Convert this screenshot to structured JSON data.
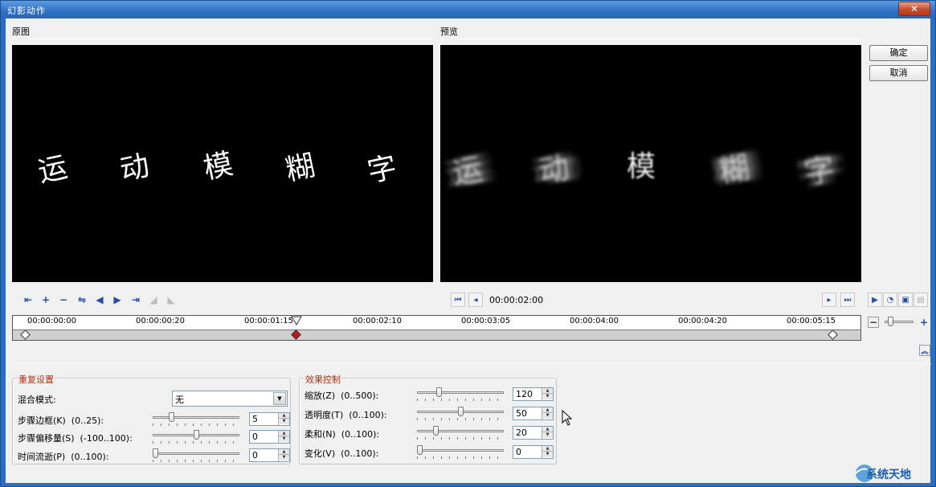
{
  "window": {
    "title": "幻影动作",
    "close_glyph": "✕"
  },
  "original": {
    "label": "原图",
    "chars": [
      "运",
      "动",
      "模",
      "糊",
      "字"
    ]
  },
  "preview": {
    "label": "预览",
    "chars": [
      "运",
      "动",
      "模",
      "糊",
      "字"
    ],
    "timecode": "00:00:02:00"
  },
  "buttons": {
    "ok": "确定",
    "cancel": "取消"
  },
  "timeline": {
    "ticks": [
      "00:00:00:00",
      "00:00:00:20",
      "00:00:01:15",
      "00:00:02:10",
      "00:00:03:05",
      "00:00:04:00",
      "00:00:04:20",
      "00:00:05:15"
    ],
    "zoom_minus": "−",
    "zoom_plus": "+",
    "collapse_glyph": "︽"
  },
  "repeat_group": {
    "title": "重复设置",
    "blend_mode_label": "混合模式:",
    "blend_mode_value": "无",
    "rows": [
      {
        "label": "步骤边框(K)  (0..25):",
        "value": "5",
        "level": 0.2
      },
      {
        "label": "步骤偏移量(S)  (-100..100):",
        "value": "0",
        "level": 0.5
      },
      {
        "label": "时间流逝(P)  (0..100):",
        "value": "0",
        "level": 0.0
      }
    ]
  },
  "effect_group": {
    "title": "效果控制",
    "rows": [
      {
        "label": "缩放(Z)  (0..500):",
        "value": "120",
        "level": 0.24
      },
      {
        "label": "透明度(T)  (0..100):",
        "value": "50",
        "level": 0.5
      },
      {
        "label": "柔和(N)  (0..100):",
        "value": "20",
        "level": 0.2
      },
      {
        "label": "变化(V)  (0..100):",
        "value": "0",
        "level": 0.0
      }
    ]
  },
  "watermark": "系统天地"
}
